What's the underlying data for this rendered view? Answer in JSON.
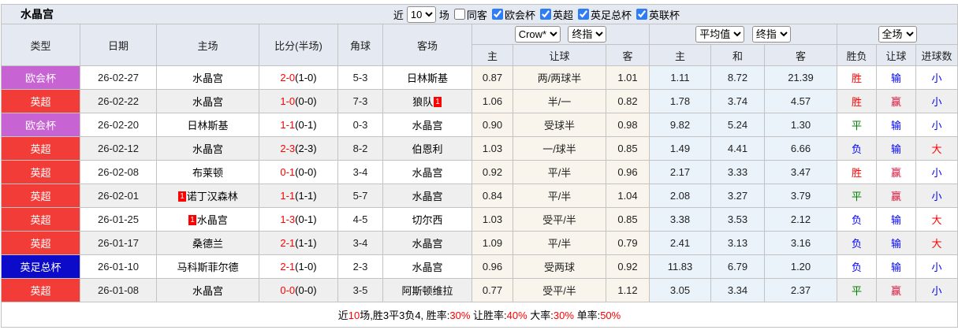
{
  "title": "水晶宫",
  "filters": {
    "recent_label": "近",
    "recent_count": "10",
    "matches_label": "场",
    "checkboxes": [
      {
        "label": "同客",
        "checked": false
      },
      {
        "label": "欧会杯",
        "checked": true
      },
      {
        "label": "英超",
        "checked": true
      },
      {
        "label": "英足总杯",
        "checked": true
      },
      {
        "label": "英联杯",
        "checked": true
      }
    ]
  },
  "selects": {
    "odds_source": "Crow*",
    "odds_final": "终指",
    "avg_mode": "平均值",
    "avg_final": "终指",
    "scope": "全场"
  },
  "table": {
    "columns": [
      "类型",
      "日期",
      "主场",
      "比分(半场)",
      "角球",
      "客场"
    ],
    "sub_columns": [
      "主",
      "让球",
      "客",
      "主",
      "和",
      "客",
      "胜负",
      "让球",
      "进球数"
    ],
    "rows": [
      {
        "league": "欧会杯",
        "date": "26-02-27",
        "home": {
          "name": "水晶宫",
          "green": true
        },
        "score": {
          "ft": "2-0",
          "ht": "(1-0)"
        },
        "corners": "5-3",
        "away": {
          "name": "日林斯基",
          "green": false
        },
        "crown": [
          "0.87",
          "两/两球半",
          "1.01"
        ],
        "avg": [
          "1.11",
          "8.72",
          "21.39"
        ],
        "results": [
          "胜",
          "输",
          "小"
        ]
      },
      {
        "league": "英超",
        "date": "26-02-22",
        "home": {
          "name": "水晶宫",
          "green": true
        },
        "score": {
          "ft": "1-0",
          "ht": "(0-0)"
        },
        "corners": "7-3",
        "away": {
          "name": "狼队",
          "green": false,
          "flag": "1",
          "flag_pos": "after"
        },
        "crown": [
          "1.06",
          "半/一",
          "0.82"
        ],
        "avg": [
          "1.78",
          "3.74",
          "4.57"
        ],
        "results": [
          "胜",
          "赢",
          "小"
        ]
      },
      {
        "league": "欧会杯",
        "date": "26-02-20",
        "home": {
          "name": "日林斯基",
          "green": false
        },
        "score": {
          "ft": "1-1",
          "ht": "(0-1)"
        },
        "corners": "0-3",
        "away": {
          "name": "水晶宫",
          "green": true
        },
        "crown": [
          "0.90",
          "受球半",
          "0.98"
        ],
        "avg": [
          "9.82",
          "5.24",
          "1.30"
        ],
        "results": [
          "平",
          "输",
          "小"
        ]
      },
      {
        "league": "英超",
        "date": "26-02-12",
        "home": {
          "name": "水晶宫",
          "green": true
        },
        "score": {
          "ft": "2-3",
          "ht": "(2-3)"
        },
        "corners": "8-2",
        "away": {
          "name": "伯恩利",
          "green": false
        },
        "crown": [
          "1.03",
          "一/球半",
          "0.85"
        ],
        "avg": [
          "1.49",
          "4.41",
          "6.66"
        ],
        "results": [
          "负",
          "输",
          "大"
        ]
      },
      {
        "league": "英超",
        "date": "26-02-08",
        "home": {
          "name": "布莱顿",
          "green": false
        },
        "score": {
          "ft": "0-1",
          "ht": "(0-0)"
        },
        "corners": "3-4",
        "away": {
          "name": "水晶宫",
          "green": true
        },
        "crown": [
          "0.92",
          "平/半",
          "0.96"
        ],
        "avg": [
          "2.17",
          "3.33",
          "3.47"
        ],
        "results": [
          "胜",
          "赢",
          "小"
        ]
      },
      {
        "league": "英超",
        "date": "26-02-01",
        "home": {
          "name": "诺丁汉森林",
          "green": false,
          "flag": "1",
          "flag_pos": "before"
        },
        "score": {
          "ft": "1-1",
          "ht": "(1-1)"
        },
        "corners": "5-7",
        "away": {
          "name": "水晶宫",
          "green": true
        },
        "crown": [
          "0.84",
          "平/半",
          "1.04"
        ],
        "avg": [
          "2.08",
          "3.27",
          "3.79"
        ],
        "results": [
          "平",
          "赢",
          "小"
        ]
      },
      {
        "league": "英超",
        "date": "26-01-25",
        "home": {
          "name": "水晶宫",
          "green": true,
          "flag": "1",
          "flag_pos": "before"
        },
        "score": {
          "ft": "1-3",
          "ht": "(0-1)"
        },
        "corners": "4-5",
        "away": {
          "name": "切尔西",
          "green": false
        },
        "crown": [
          "1.03",
          "受平/半",
          "0.85"
        ],
        "avg": [
          "3.38",
          "3.53",
          "2.12"
        ],
        "results": [
          "负",
          "输",
          "大"
        ]
      },
      {
        "league": "英超",
        "date": "26-01-17",
        "home": {
          "name": "桑德兰",
          "green": false
        },
        "score": {
          "ft": "2-1",
          "ht": "(1-1)"
        },
        "corners": "3-4",
        "away": {
          "name": "水晶宫",
          "green": true
        },
        "crown": [
          "1.09",
          "平/半",
          "0.79"
        ],
        "avg": [
          "2.41",
          "3.13",
          "3.16"
        ],
        "results": [
          "负",
          "输",
          "大"
        ]
      },
      {
        "league": "英足总杯",
        "date": "26-01-10",
        "home": {
          "name": "马科斯菲尔德",
          "green": false
        },
        "score": {
          "ft": "2-1",
          "ht": "(1-0)"
        },
        "corners": "2-3",
        "away": {
          "name": "水晶宫",
          "green": true
        },
        "crown": [
          "0.96",
          "受两球",
          "0.92"
        ],
        "avg": [
          "11.83",
          "6.79",
          "1.20"
        ],
        "results": [
          "负",
          "输",
          "小"
        ]
      },
      {
        "league": "英超",
        "date": "26-01-08",
        "home": {
          "name": "水晶宫",
          "green": true
        },
        "score": {
          "ft": "0-0",
          "ht": "(0-0)"
        },
        "corners": "3-5",
        "away": {
          "name": "阿斯顿维拉",
          "green": false
        },
        "crown": [
          "0.77",
          "受平/半",
          "1.12"
        ],
        "avg": [
          "3.05",
          "3.34",
          "2.37"
        ],
        "results": [
          "平",
          "赢",
          "小"
        ]
      }
    ]
  },
  "summary": {
    "segments": [
      {
        "text": "近",
        "red": false
      },
      {
        "text": "10",
        "red": true
      },
      {
        "text": "场,胜3平3负4, 胜率:",
        "red": false
      },
      {
        "text": "30%",
        "red": true
      },
      {
        "text": " 让胜率:",
        "red": false
      },
      {
        "text": "40%",
        "red": true
      },
      {
        "text": " 大率:",
        "red": false
      },
      {
        "text": "30%",
        "red": true
      },
      {
        "text": " 单率:",
        "red": false
      },
      {
        "text": "50%",
        "red": true
      }
    ]
  },
  "colors": {
    "league": {
      "欧会杯": "#C763D3",
      "英超": "#F23C38",
      "英足总杯": "#0B0BC9"
    },
    "result": {
      "胜": "#FF0000",
      "平": "#008000",
      "负": "#0000FF",
      "赢": "#DC143C",
      "输": "#0000FF",
      "大": "#FF0000",
      "小": "#0000FF"
    },
    "team_green": "#008800",
    "score_red": "#FF0000",
    "card_badge": "#FF0000",
    "crown_bg": "#FAF5EC",
    "avg_bg": "#EAF3F9",
    "alt_row_bg": "#EFEFEF",
    "header_bg": "#E5EAF2"
  }
}
